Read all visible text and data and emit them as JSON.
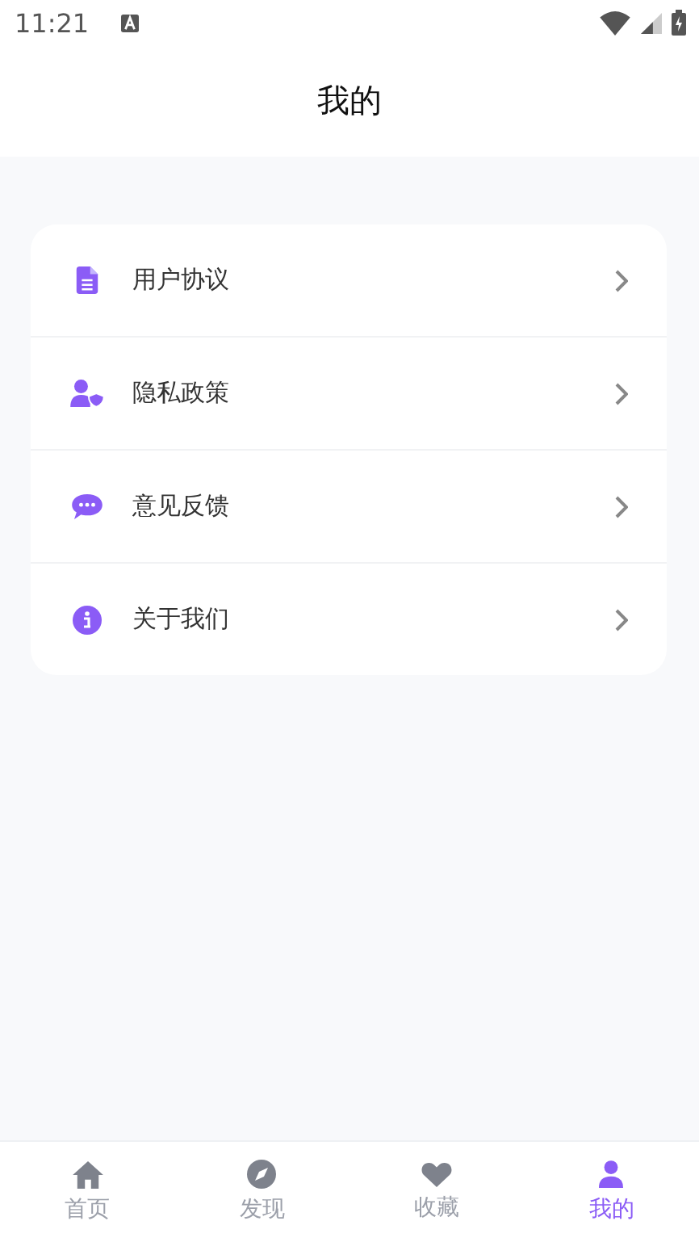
{
  "status_bar": {
    "time": "11:21"
  },
  "header": {
    "title": "我的"
  },
  "menu": [
    {
      "kind": "document",
      "label": "用户协议"
    },
    {
      "kind": "privacy",
      "label": "隐私政策"
    },
    {
      "kind": "feedback",
      "label": "意见反馈"
    },
    {
      "kind": "info",
      "label": "关于我们"
    }
  ],
  "tabs": [
    {
      "kind": "home",
      "label": "首页",
      "selected": false
    },
    {
      "kind": "discover",
      "label": "发现",
      "selected": false
    },
    {
      "kind": "favorite",
      "label": "收藏",
      "selected": false
    },
    {
      "kind": "profile",
      "label": "我的",
      "selected": true
    }
  ]
}
